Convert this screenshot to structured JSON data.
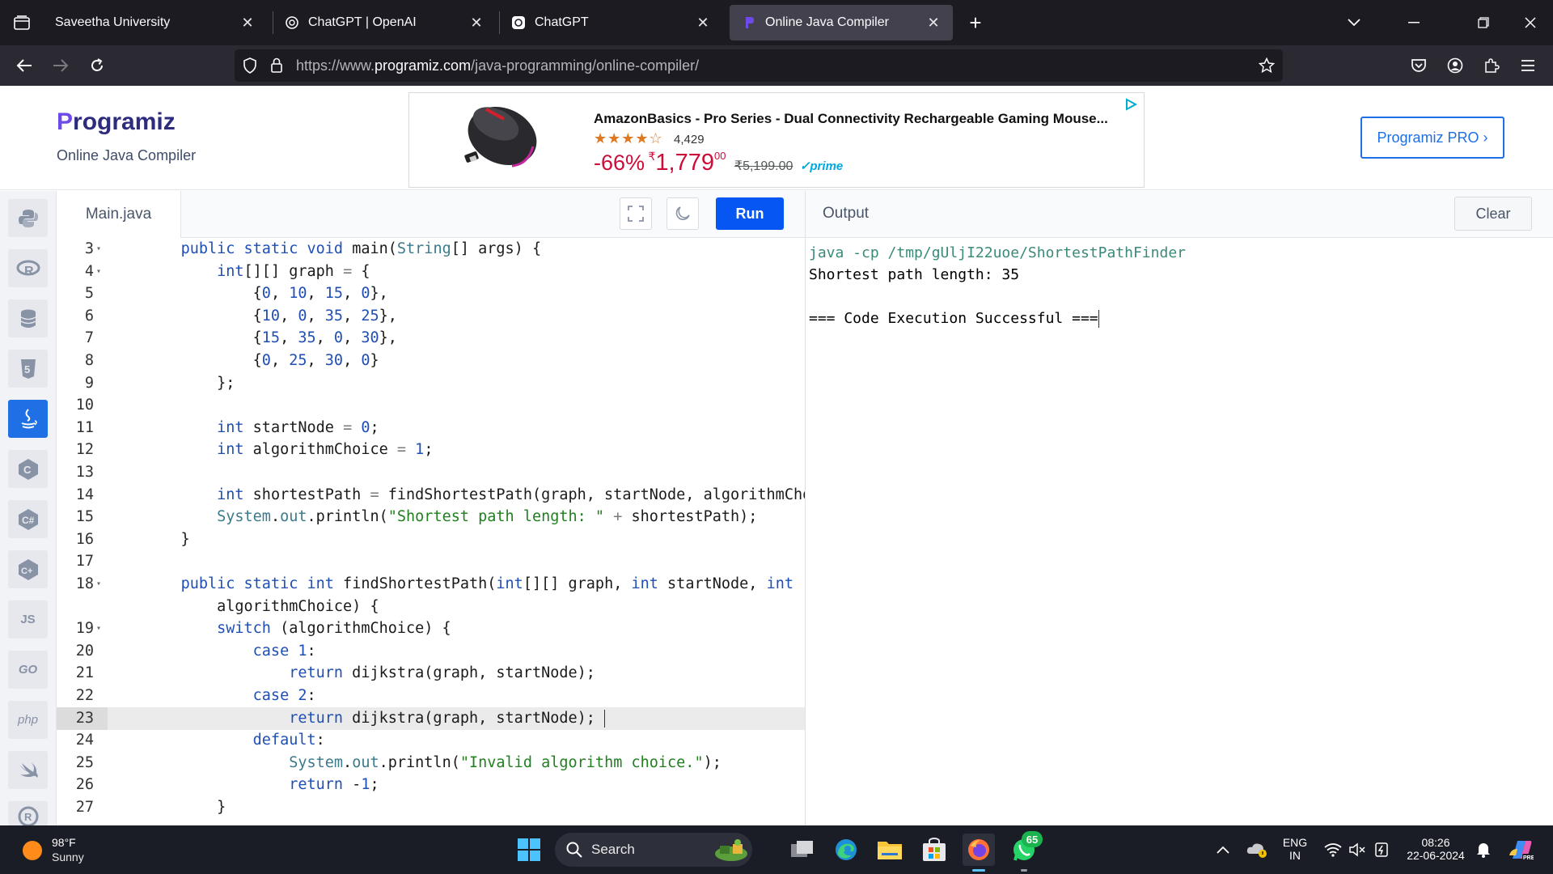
{
  "browser": {
    "tabs": [
      {
        "title": "Saveetha University",
        "active": false
      },
      {
        "title": "ChatGPT | OpenAI",
        "active": false
      },
      {
        "title": "ChatGPT",
        "active": false
      },
      {
        "title": "Online Java Compiler",
        "active": true
      }
    ],
    "url_prefix": "https://www.",
    "url_host": "programiz.com",
    "url_path": "/java-programming/online-compiler/"
  },
  "site": {
    "logo_text": "rogramiz",
    "logo_initial": "P",
    "subtitle": "Online Java Compiler",
    "pro_button": "Programiz PRO ›"
  },
  "ad": {
    "title": "AmazonBasics - Pro Series - Dual Connectivity Rechargeable Gaming Mouse...",
    "stars": "★★★★☆",
    "rating_count": "4,429",
    "discount": "-66%",
    "currency": "₹",
    "price": "1,779",
    "price_decimal": "00",
    "old_price": "₹5,199.00",
    "prime": "✓prime"
  },
  "languages": [
    "python",
    "r",
    "sql",
    "html",
    "java",
    "c",
    "csharp",
    "cpp",
    "JS",
    "GO",
    "php",
    "swift",
    "rust"
  ],
  "editor": {
    "file_name": "Main.java",
    "run_label": "Run",
    "current_line": 23
  },
  "code_lines": [
    {
      "n": "3",
      "fold": true,
      "text": "    public static void main(String[] args) {"
    },
    {
      "n": "4",
      "fold": true,
      "text": "        int[][] graph = {"
    },
    {
      "n": "5",
      "fold": false,
      "text": "            {0, 10, 15, 0},"
    },
    {
      "n": "6",
      "fold": false,
      "text": "            {10, 0, 35, 25},"
    },
    {
      "n": "7",
      "fold": false,
      "text": "            {15, 35, 0, 30},"
    },
    {
      "n": "8",
      "fold": false,
      "text": "            {0, 25, 30, 0}"
    },
    {
      "n": "9",
      "fold": false,
      "text": "        };"
    },
    {
      "n": "10",
      "fold": false,
      "text": ""
    },
    {
      "n": "11",
      "fold": false,
      "text": "        int startNode = 0;"
    },
    {
      "n": "12",
      "fold": false,
      "text": "        int algorithmChoice = 1;"
    },
    {
      "n": "13",
      "fold": false,
      "text": ""
    },
    {
      "n": "14",
      "fold": false,
      "text": "        int shortestPath = findShortestPath(graph, startNode, algorithmChoice);"
    },
    {
      "n": "15",
      "fold": false,
      "text": "        System.out.println(\"Shortest path length: \" + shortestPath);"
    },
    {
      "n": "16",
      "fold": false,
      "text": "    }"
    },
    {
      "n": "17",
      "fold": false,
      "text": ""
    },
    {
      "n": "18",
      "fold": true,
      "text": "    public static int findShortestPath(int[][] graph, int startNode, int"
    },
    {
      "n": "",
      "fold": false,
      "text": "        algorithmChoice) {"
    },
    {
      "n": "19",
      "fold": true,
      "text": "        switch (algorithmChoice) {"
    },
    {
      "n": "20",
      "fold": false,
      "text": "            case 1:"
    },
    {
      "n": "21",
      "fold": false,
      "text": "                return dijkstra(graph, startNode);"
    },
    {
      "n": "22",
      "fold": false,
      "text": "            case 2:"
    },
    {
      "n": "23",
      "fold": false,
      "text": "                return dijkstra(graph, startNode);"
    },
    {
      "n": "24",
      "fold": false,
      "text": "            default:"
    },
    {
      "n": "25",
      "fold": false,
      "text": "                System.out.println(\"Invalid algorithm choice.\");"
    },
    {
      "n": "26",
      "fold": false,
      "text": "                return -1;"
    },
    {
      "n": "27",
      "fold": false,
      "text": "        }"
    }
  ],
  "output": {
    "title": "Output",
    "clear_label": "Clear",
    "lines": [
      "java -cp /tmp/gUljI22uoe/ShortestPathFinder",
      "Shortest path length: 35",
      "",
      "=== Code Execution Successful ==="
    ]
  },
  "taskbar": {
    "temperature": "98°F",
    "condition": "Sunny",
    "search_label": "Search",
    "lang_line1": "ENG",
    "lang_line2": "IN",
    "time": "08:26",
    "date": "22-06-2024",
    "whatsapp_badge": "65"
  },
  "colors": {
    "accent": "#0556f3",
    "keyword": "#1f4fb5",
    "string": "#20801f"
  }
}
